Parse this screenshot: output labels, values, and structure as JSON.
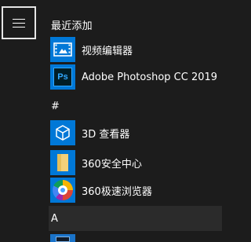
{
  "menu": {
    "hamburger_icon": "hamburger-menu-icon"
  },
  "groups": {
    "recent_header": "最近添加",
    "hash_header": "#",
    "a_header": "A"
  },
  "apps": [
    {
      "label": "视频编辑器",
      "icon": "video-editor-icon",
      "tile_color": "#0078d7"
    },
    {
      "label": "Adobe Photoshop CC 2019",
      "icon": "photoshop-icon",
      "tile_color": "#0078d7"
    },
    {
      "label": "3D 查看器",
      "icon": "3d-viewer-icon",
      "tile_color": "#0078d7"
    },
    {
      "label": "360安全中心",
      "icon": "360-security-folder-icon",
      "tile_color": "#0078d7"
    },
    {
      "label": "360极速浏览器",
      "icon": "360-browser-icon",
      "tile_color": "#0078d7"
    }
  ],
  "photoshop_tile_text": "Ps"
}
